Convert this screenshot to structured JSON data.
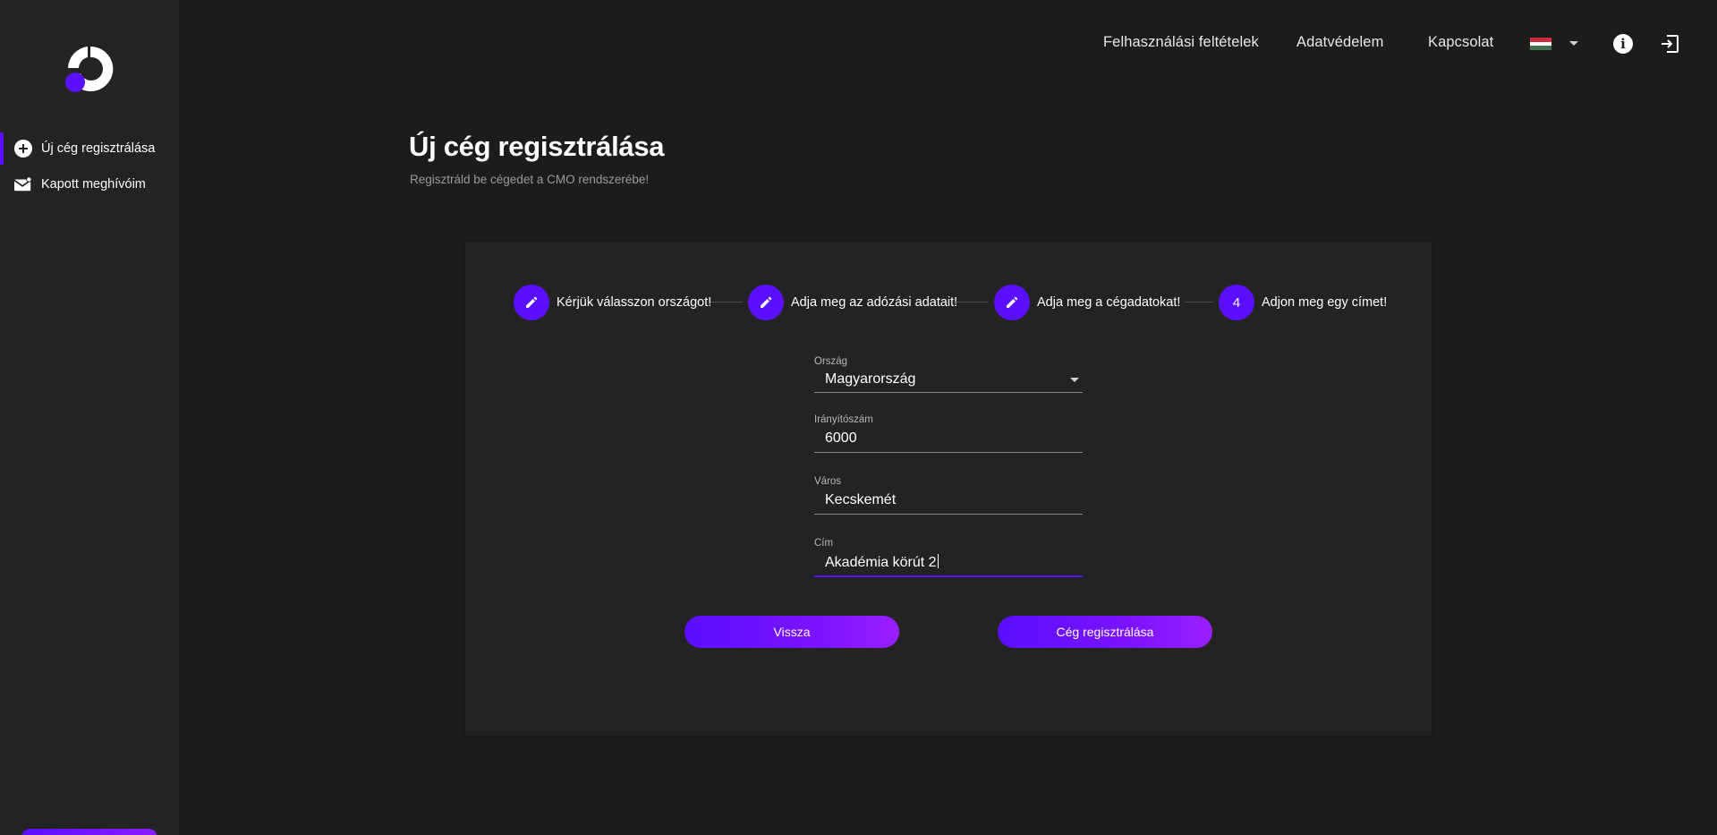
{
  "sidebar": {
    "items": [
      {
        "label": "Új cég regisztrálása",
        "icon": "add-circle-icon",
        "active": true
      },
      {
        "label": "Kapott meghívóim",
        "icon": "mail-icon",
        "active": false
      }
    ]
  },
  "header": {
    "links": [
      "Felhasználási feltételek",
      "Adatvédelem",
      "Kapcsolat"
    ],
    "language_flag": "hungary-flag-icon",
    "info_icon": "i"
  },
  "page": {
    "title": "Új cég regisztrálása",
    "subtitle": "Regisztráld be cégedet a CMO rendszerébe!"
  },
  "stepper": {
    "steps": [
      {
        "label": "Kérjük válasszon országot!",
        "icon": "pencil-icon"
      },
      {
        "label": "Adja meg az adózási adatait!",
        "icon": "pencil-icon"
      },
      {
        "label": "Adja meg a cégadatokat!",
        "icon": "pencil-icon"
      },
      {
        "label": "Adjon meg egy címet!",
        "number": "4"
      }
    ]
  },
  "form": {
    "country": {
      "label": "Ország",
      "value": "Magyarország"
    },
    "zip": {
      "label": "Irányítószám",
      "value": "6000"
    },
    "city": {
      "label": "Város",
      "value": "Kecskemét"
    },
    "address": {
      "label": "Cím",
      "value": "Akadémia körút 2"
    }
  },
  "buttons": {
    "back": "Vissza",
    "register": "Cég regisztrálása"
  },
  "colors": {
    "accent": "#5a0fff",
    "accent_end": "#9a1fff",
    "background": "#1c1c1c",
    "panel": "#232323"
  }
}
